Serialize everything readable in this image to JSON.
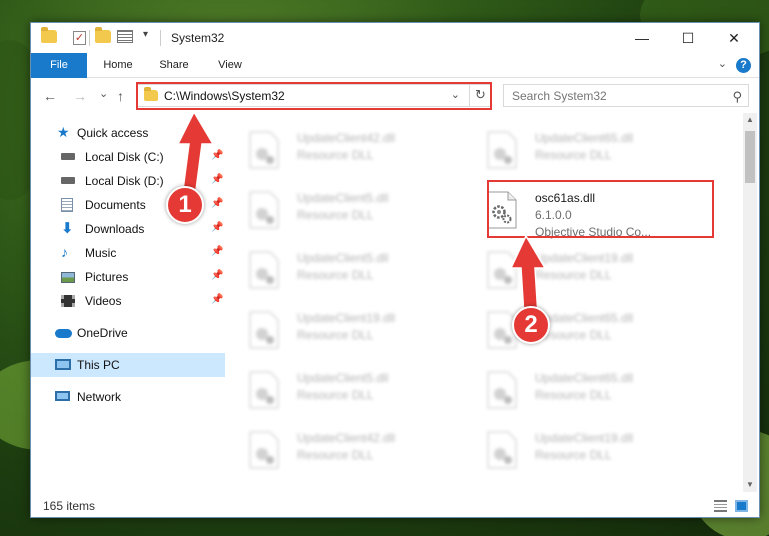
{
  "window": {
    "title": "System32"
  },
  "titlebar": {
    "minimize": "—",
    "maximize": "☐",
    "close": "✕"
  },
  "ribbon": {
    "tabs": [
      "File",
      "Home",
      "Share",
      "View"
    ],
    "help": "?"
  },
  "nav": {
    "back": "←",
    "forward": "→",
    "recent": "⌄",
    "up": "↑",
    "address": "C:\\Windows\\System32",
    "search_placeholder": "Search System32"
  },
  "sidebar": {
    "items": [
      {
        "label": "Quick access"
      },
      {
        "label": "Local Disk (C:)"
      },
      {
        "label": "Local Disk (D:)"
      },
      {
        "label": "Documents"
      },
      {
        "label": "Downloads"
      },
      {
        "label": "Music"
      },
      {
        "label": "Pictures"
      },
      {
        "label": "Videos"
      },
      {
        "label": "OneDrive"
      },
      {
        "label": "This PC"
      },
      {
        "label": "Network"
      }
    ]
  },
  "files": [
    {
      "name": "UpdateClient42.dll",
      "desc": "Resource DLL"
    },
    {
      "name": "UpdateClient65.dll",
      "desc": "Resource DLL"
    },
    {
      "name": "UpdateClient5.dll",
      "desc": "Resource DLL"
    },
    {
      "name": "osc61as.dll",
      "version": "6.1.0.0",
      "desc": "Objective Studio Co..."
    },
    {
      "name": "UpdateClient5.dll",
      "desc": "Resource DLL"
    },
    {
      "name": "UpdateClient19.dll",
      "desc": "Resource DLL"
    },
    {
      "name": "UpdateClient19.dll",
      "desc": "Resource DLL"
    },
    {
      "name": "UpdateClient65.dll",
      "desc": "Resource DLL"
    },
    {
      "name": "UpdateClient5.dll",
      "desc": "Resource DLL"
    },
    {
      "name": "UpdateClient65.dll",
      "desc": "Resource DLL"
    },
    {
      "name": "UpdateClient42.dll",
      "desc": "Resource DLL"
    },
    {
      "name": "UpdateClient19.dll",
      "desc": "Resource DLL"
    }
  ],
  "status": {
    "item_count": "165 items"
  },
  "annotations": {
    "step1": "1",
    "step2": "2",
    "color": "#e53935"
  }
}
